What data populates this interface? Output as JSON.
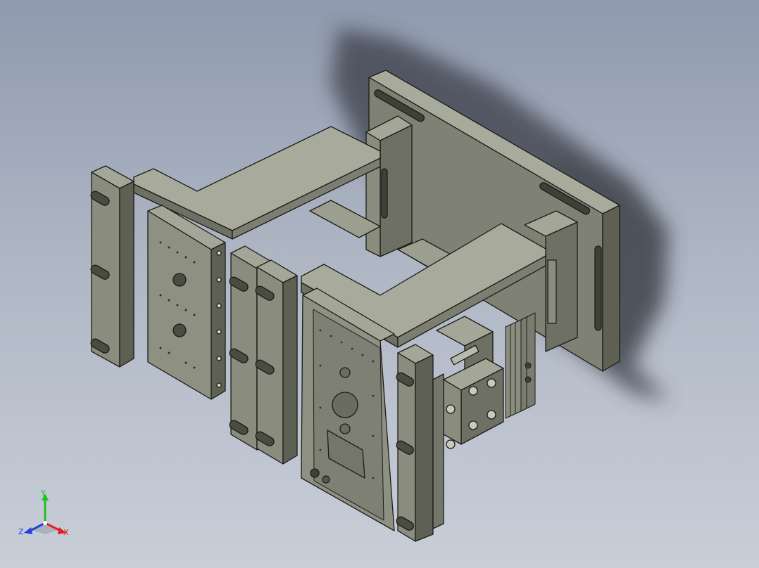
{
  "viewport": {
    "background_top": "#8f9aae",
    "background_bottom": "#c9ced8"
  },
  "model": {
    "part_color": "#8a8c7e",
    "part_light": "#a4a697",
    "part_dark": "#5e6054",
    "edge_color": "#1c1c18",
    "shadow_color": "#3a3e46"
  },
  "triad": {
    "x_label": "X",
    "y_label": "Y",
    "z_label": "Z",
    "x_color": "#e02020",
    "y_color": "#20c020",
    "z_color": "#2040e0"
  }
}
